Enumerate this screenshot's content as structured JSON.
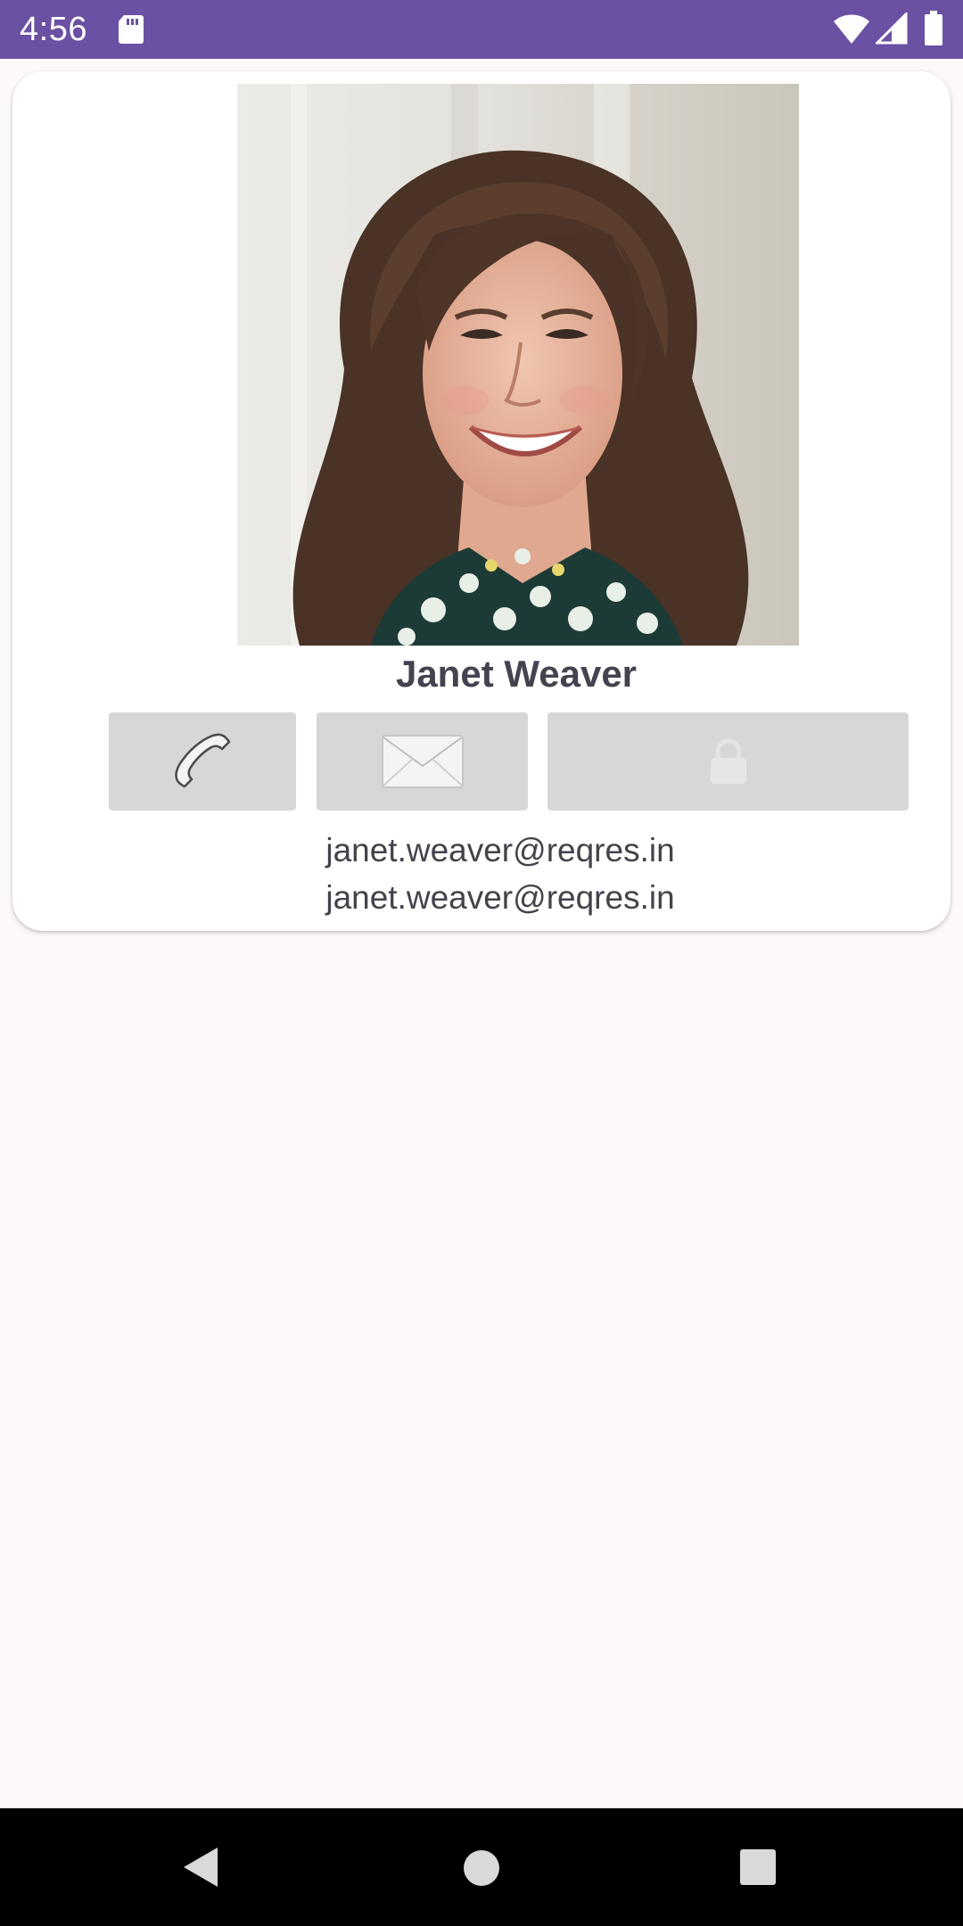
{
  "status_bar": {
    "time": "4:56",
    "icons": [
      "sd-card-icon",
      "wifi-icon",
      "signal-icon",
      "battery-icon"
    ],
    "background_color": "#6a51a3"
  },
  "profile": {
    "name": "Janet Weaver",
    "emails": [
      "janet.weaver@reqres.in",
      "janet.weaver@reqres.in"
    ],
    "photo": "avatar-photo"
  },
  "actions": [
    {
      "icon": "phone-icon"
    },
    {
      "icon": "envelope-icon"
    },
    {
      "icon": "lock-icon"
    }
  ],
  "nav_bar": {
    "icons": [
      "back-icon",
      "home-icon",
      "recents-icon"
    ]
  }
}
